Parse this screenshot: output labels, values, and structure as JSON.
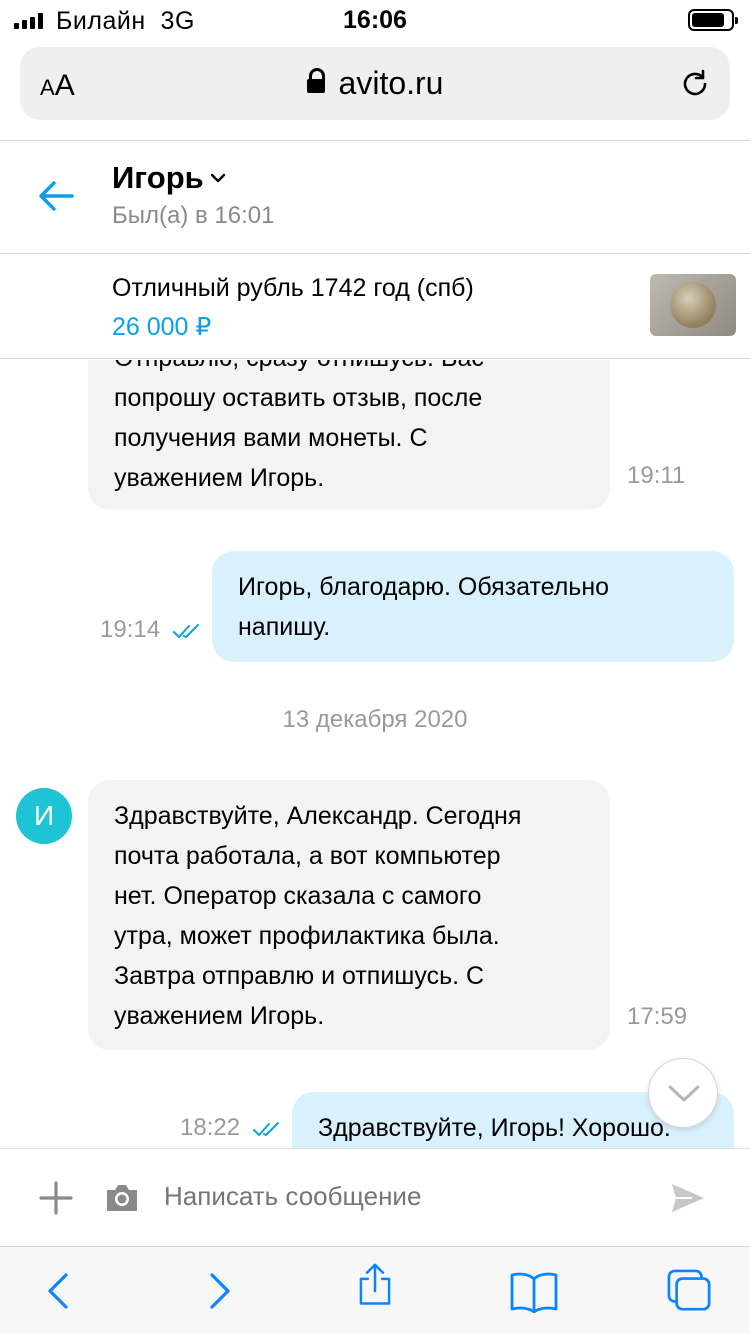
{
  "status_bar": {
    "carrier": "Билайн",
    "network": "3G",
    "time": "16:06",
    "battery_level": 0.85
  },
  "browser": {
    "text_size_label_small": "A",
    "text_size_label_large": "A",
    "domain": "avito.ru",
    "icons": [
      "lock-icon",
      "reload-icon"
    ]
  },
  "chat": {
    "contact_name": "Игорь",
    "last_seen": "Был(а) в 16:01"
  },
  "product": {
    "title": "Отличный рубль 1742 год (спб)",
    "price": "26 000 ₽"
  },
  "messages": [
    {
      "direction": "incoming",
      "lines": [
        "Отправлю, сразу отпишусь. Вас",
        "попрошу оставить отзыв, после",
        "получения вами монеты. С",
        "уважением Игорь."
      ],
      "time": "19:11"
    },
    {
      "direction": "outgoing",
      "lines": [
        "Игорь, благодарю. Обязательно",
        "напишу."
      ],
      "time": "19:14",
      "read": true
    },
    {
      "type": "date",
      "text": "13 декабря 2020"
    },
    {
      "direction": "incoming",
      "avatar_letter": "И",
      "lines": [
        "Здравствуйте, Александр. Сегодня",
        "почта работала, а вот компьютер",
        "нет. Оператор сказала с самого",
        "утра, может профилактика была.",
        "Завтра отправлю и отпишусь. С",
        "уважением Игорь."
      ],
      "time": "17:59"
    },
    {
      "direction": "outgoing",
      "lines": [
        "Здравствуйте, Игорь! Хорошо."
      ],
      "time": "18:22",
      "read": true
    }
  ],
  "composer": {
    "placeholder": "Написать сообщение"
  },
  "colors": {
    "accent": "#0aa0e8",
    "incoming_bubble": "#f3f3f3",
    "outgoing_bubble": "#d8f1fd",
    "avatar": "#1ec3d6",
    "ios_blue": "#0a84ff"
  },
  "toolbar_icons": [
    "back-icon",
    "forward-icon",
    "share-icon",
    "bookmarks-icon",
    "tabs-icon"
  ]
}
